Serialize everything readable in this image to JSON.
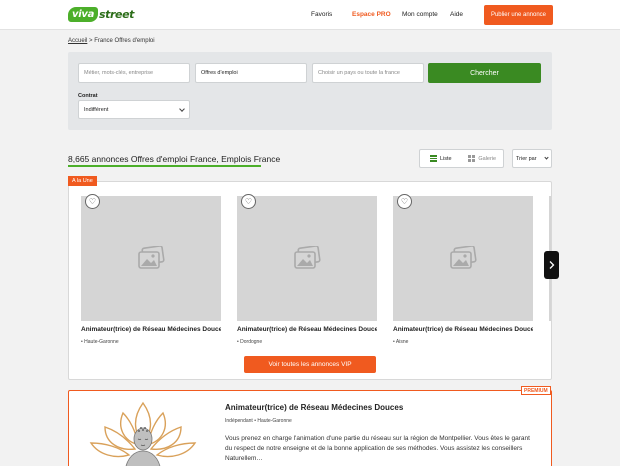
{
  "header": {
    "logo_badge": "viva",
    "logo_text": "street",
    "nav": {
      "favoris": "Favoris",
      "espace_pro": "Espace PRO",
      "mon_compte": "Mon compte",
      "aide": "Aide"
    },
    "publish_label": "Publier une annonce"
  },
  "breadcrumb": {
    "home": "Accueil",
    "separator": ">",
    "current": "France Offres d'emploi"
  },
  "search": {
    "keywords_placeholder": "Métier, mots-clés, entreprise",
    "category_value": "Offres d'emploi",
    "location_placeholder": "Choisir un pays ou toute la france",
    "button_label": "Chercher",
    "contract_label": "Contrat",
    "contract_value": "Indifférent"
  },
  "results": {
    "title": "8,665 annonces Offres d'emploi France, Emplois France",
    "view_list": "Liste",
    "view_gallery": "Galerie",
    "sort_label": "Trier par"
  },
  "featured": {
    "tag": "A la Une",
    "cards": [
      {
        "title": "Animateur(trice) de Réseau Médecines Douces",
        "location": "Haute-Garonne"
      },
      {
        "title": "Animateur(trice) de Réseau Médecines Douces",
        "location": "Dordogne"
      },
      {
        "title": "Animateur(trice) de Réseau Médecines Douces",
        "location": "Aisne"
      }
    ],
    "vip_button": "Voir toutes les annonces VIP"
  },
  "premium": {
    "tag": "PREMIUM",
    "title": "Animateur(trice) de Réseau Médecines Douces",
    "contract": "Indépendant",
    "location": "Haute-Garonne",
    "description": "Vous prenez en charge l'animation d'une partie du réseau sur la région de Montpellier. Vous êtes le garant du respect de notre enseigne et de la bonne application de ses méthodes. Vous assistez les conseillers Naturellem…"
  },
  "colors": {
    "brand_green": "#4caf2a",
    "search_green": "#3a8a22",
    "accent_orange": "#f05a1f"
  }
}
